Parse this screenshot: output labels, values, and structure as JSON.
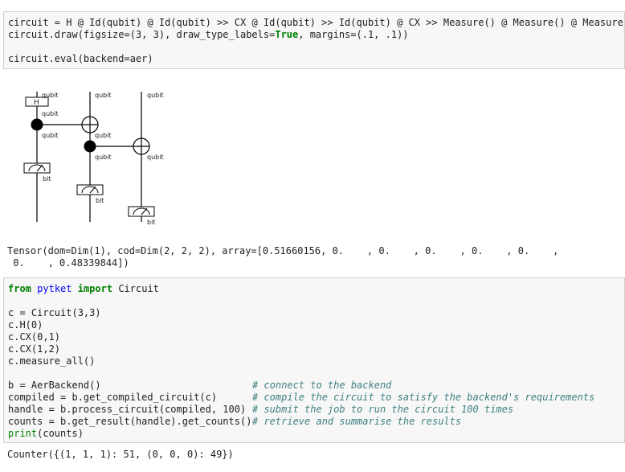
{
  "cell1": {
    "line1": {
      "a": "circuit ",
      "b": "= H @ Id(qubit) @ Id(qubit) ",
      "c": ">>",
      "d": " CX @ Id(qubit) ",
      "e": ">>",
      "f": " Id(qubit) @ CX ",
      "g": ">>",
      "h": " Measure() @ Measure() @ Measure()"
    },
    "line2": {
      "a": "circuit.draw(figsize=(3, 3), draw_type_labels=",
      "b": "True",
      "c": ", margins=(.1, .1))"
    },
    "line3": "circuit.eval(backend=aer)"
  },
  "diagram": {
    "h_label": "H",
    "qubit_label": "qubit",
    "bit_label": "bit"
  },
  "output1": {
    "line1": "Tensor(dom=Dim(1), cod=Dim(2, 2, 2), array=[0.51660156, 0.    , 0.    , 0.    , 0.    , 0.    ,",
    "line2": " 0.    , 0.48339844])"
  },
  "cell2": {
    "l1": {
      "from": "from",
      "module": "pytket",
      "import": "import",
      "rest": " Circuit"
    },
    "l3": "c = Circuit(3,3)",
    "l4": "c.H(0)",
    "l5": "c.CX(0,1)",
    "l6": "c.CX(1,2)",
    "l7": "c.measure_all()",
    "l9": {
      "code": "b = AerBackend()                  ",
      "comment": "# connect to the backend"
    },
    "l10": {
      "code": "compiled = b.get_compiled_circuit(c)  ",
      "comment": "# compile the circuit to satisfy the backend's requirements"
    },
    "l11": {
      "code": "handle = b.process_circuit(compiled, 100)  ",
      "comment": "# submit the job to run the circuit 100 times"
    },
    "l12": {
      "code": "counts = b.get_result(handle).get_counts()  ",
      "comment": "# retrieve and summarise the results"
    },
    "l13": {
      "print": "print",
      "rest": "(counts)"
    }
  },
  "output2": "Counter({(1, 1, 1): 51, (0, 0, 0): 49})"
}
